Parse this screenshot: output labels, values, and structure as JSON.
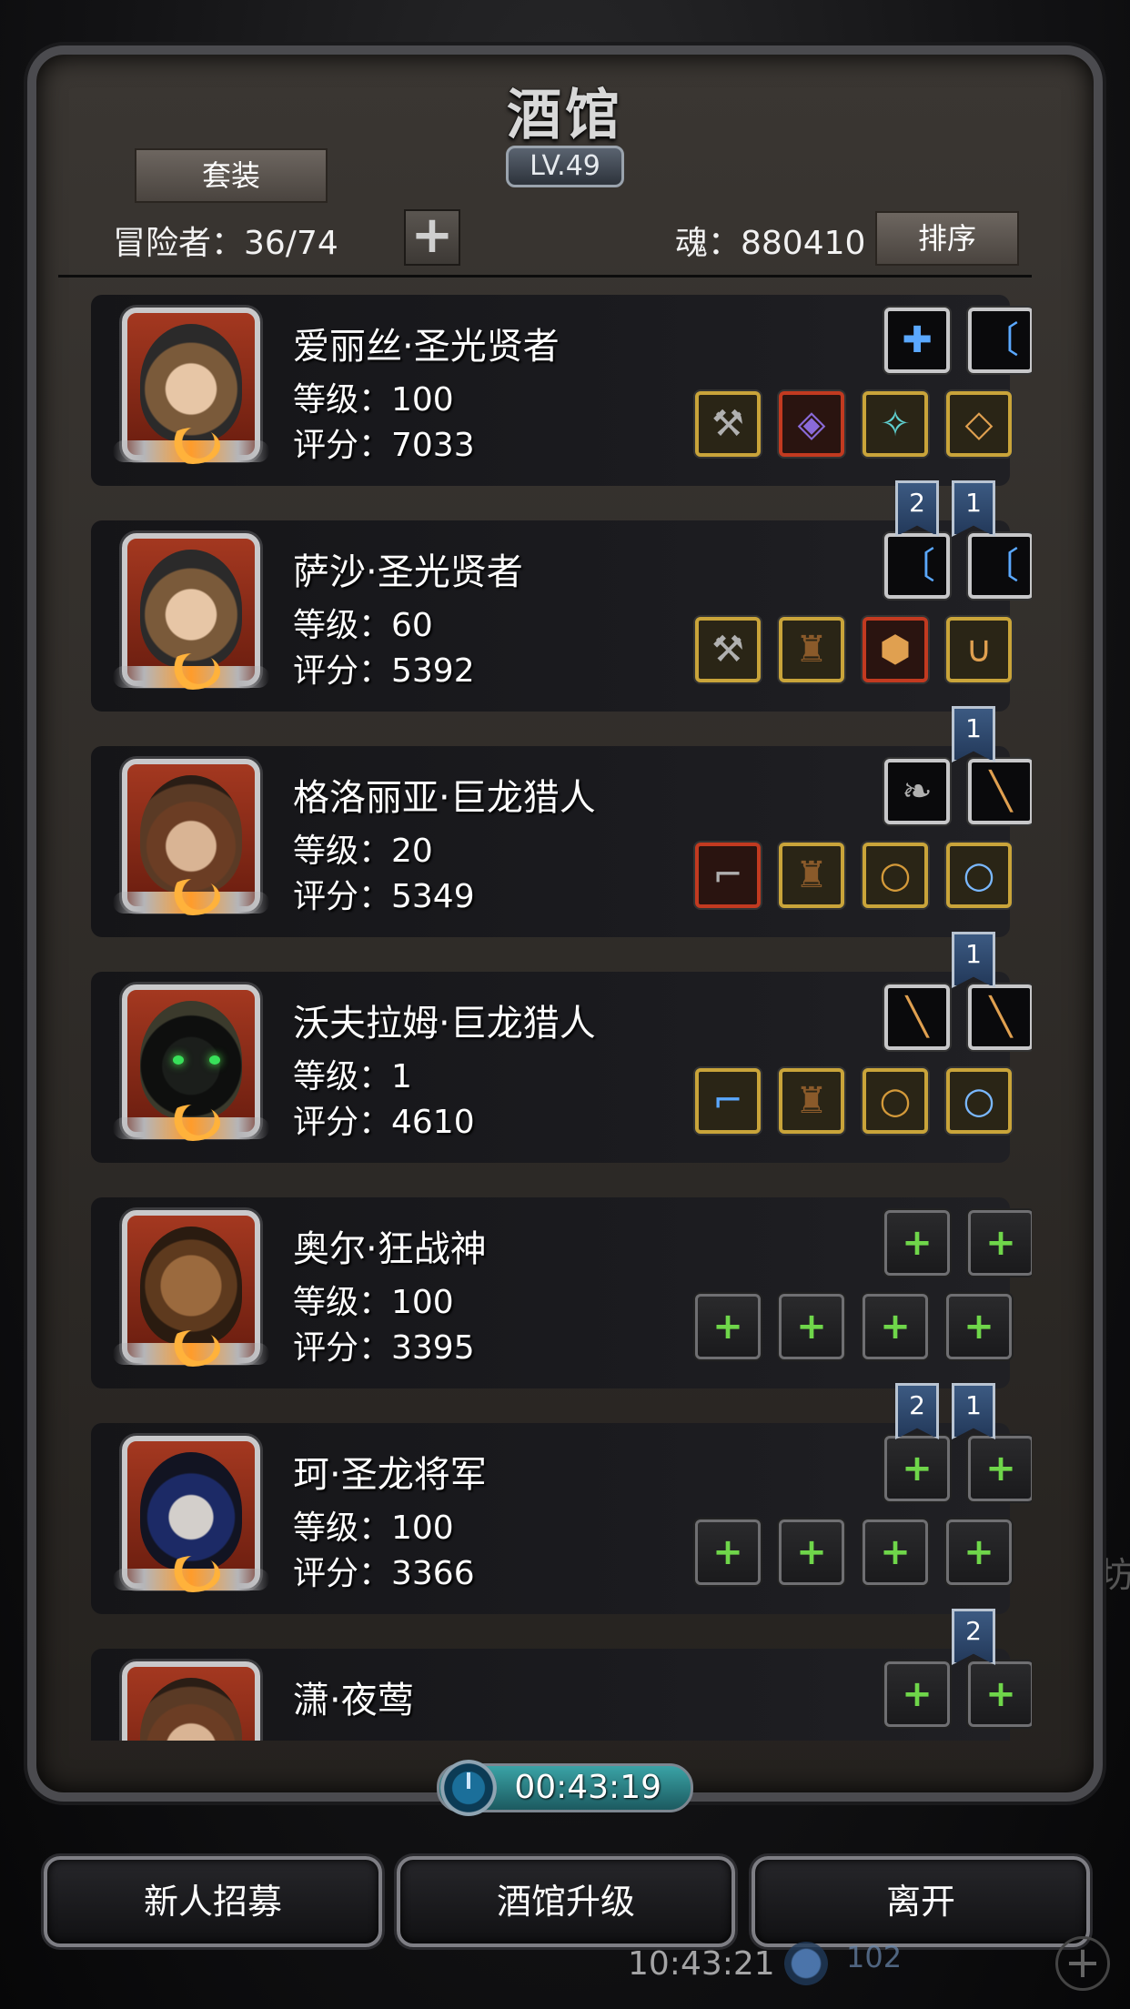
{
  "header": {
    "title": "酒馆",
    "level": "LV.49",
    "suit_button": "套装",
    "adventurers_label": "冒险者：36/74",
    "soul_label": "魂：880410",
    "sort_button": "排序"
  },
  "heroes": [
    {
      "name": "爱丽丝·圣光贤者",
      "level_text": "等级：100",
      "score_text": "评分：7033",
      "portrait_icon": "hooded-sage-portrait",
      "top_slots": [
        {
          "icon": "amulet-icon",
          "style": "white",
          "glyph": "✚",
          "color": "g-blue"
        },
        {
          "icon": "bow-icon",
          "style": "white",
          "glyph": "〔",
          "color": "g-blue"
        }
      ],
      "bottom_slots": [
        {
          "icon": "hammer-icon",
          "style": "gold",
          "glyph": "⚒",
          "color": "g-metal"
        },
        {
          "icon": "armor-icon",
          "style": "red",
          "glyph": "◈",
          "color": "g-purple"
        },
        {
          "icon": "pendant-icon",
          "style": "gold",
          "glyph": "✧",
          "color": "g-teal"
        },
        {
          "icon": "tablet-icon",
          "style": "gold",
          "glyph": "◇",
          "color": "g-orange"
        }
      ]
    },
    {
      "name": "萨沙·圣光贤者",
      "level_text": "等级：60",
      "score_text": "评分：5392",
      "portrait_icon": "hooded-sage-portrait",
      "top_slots": [
        {
          "icon": "bow-icon",
          "style": "white",
          "glyph": "〔",
          "color": "g-blue"
        },
        {
          "icon": "bow-icon",
          "style": "white",
          "glyph": "〔",
          "color": "g-blue"
        }
      ],
      "bottom_slots": [
        {
          "icon": "mace-icon",
          "style": "gold",
          "glyph": "⚒",
          "color": "g-metal"
        },
        {
          "icon": "cloak-icon",
          "style": "gold",
          "glyph": "♜",
          "color": "g-brown"
        },
        {
          "icon": "dice-icon",
          "style": "red",
          "glyph": "⬢",
          "color": "g-orange"
        },
        {
          "icon": "necklace-icon",
          "style": "gold",
          "glyph": "∪",
          "color": "g-orange"
        }
      ]
    },
    {
      "name": "格洛丽亚·巨龙猎人",
      "level_text": "等级：20",
      "score_text": "评分：5349",
      "portrait_icon": "hunter-portrait",
      "top_slots": [
        {
          "icon": "feather-icon",
          "style": "white",
          "glyph": "❧",
          "color": "g-metal"
        },
        {
          "icon": "sword-icon",
          "style": "white",
          "glyph": "╲",
          "color": "g-orange"
        }
      ],
      "bottom_slots": [
        {
          "icon": "pistol-icon",
          "style": "red",
          "glyph": "⌐",
          "color": "g-metal"
        },
        {
          "icon": "cloak-icon",
          "style": "gold",
          "glyph": "♜",
          "color": "g-brown"
        },
        {
          "icon": "ring-icon",
          "style": "gold",
          "glyph": "○",
          "color": "g-ring"
        },
        {
          "icon": "ring-icon",
          "style": "gold",
          "glyph": "○",
          "color": "g-ring-blue"
        }
      ]
    },
    {
      "name": "沃夫拉姆·巨龙猎人",
      "level_text": "等级：1",
      "score_text": "评分：4610",
      "portrait_icon": "hooded-hunter-portrait",
      "top_slots": [
        {
          "icon": "sword-icon",
          "style": "white",
          "glyph": "╲",
          "color": "g-orange"
        },
        {
          "icon": "sword-icon",
          "style": "white",
          "glyph": "╲",
          "color": "g-orange"
        }
      ],
      "bottom_slots": [
        {
          "icon": "pistol-icon",
          "style": "gold",
          "glyph": "⌐",
          "color": "g-blue"
        },
        {
          "icon": "cloak-icon",
          "style": "gold",
          "glyph": "♜",
          "color": "g-brown"
        },
        {
          "icon": "ring-icon",
          "style": "gold",
          "glyph": "○",
          "color": "g-ring"
        },
        {
          "icon": "ring-icon",
          "style": "gold",
          "glyph": "○",
          "color": "g-ring-blue"
        }
      ]
    },
    {
      "name": "奥尔·狂战神",
      "level_text": "等级：100",
      "score_text": "评分：3395",
      "portrait_icon": "berserker-portrait",
      "top_slots": [
        {
          "icon": "add-weapon-icon",
          "style": "empty",
          "glyph": "+",
          "color": "g-green"
        },
        {
          "icon": "add-weapon-icon",
          "style": "empty",
          "glyph": "+",
          "color": "g-green"
        }
      ],
      "bottom_slots": [
        {
          "icon": "add-weapon-icon",
          "style": "empty",
          "glyph": "+",
          "color": "g-green"
        },
        {
          "icon": "add-armor-icon",
          "style": "empty",
          "glyph": "+",
          "color": "g-green"
        },
        {
          "icon": "add-accessory-icon",
          "style": "empty",
          "glyph": "+",
          "color": "g-green"
        },
        {
          "icon": "add-accessory-icon",
          "style": "empty",
          "glyph": "+",
          "color": "g-green"
        }
      ]
    },
    {
      "name": "珂·圣龙将军",
      "level_text": "等级：100",
      "score_text": "评分：3366",
      "portrait_icon": "general-portrait",
      "top_slots": [
        {
          "icon": "add-weapon-icon",
          "style": "empty",
          "glyph": "+",
          "color": "g-green"
        },
        {
          "icon": "add-weapon-icon",
          "style": "empty",
          "glyph": "+",
          "color": "g-green"
        }
      ],
      "bottom_slots": [
        {
          "icon": "add-weapon-icon",
          "style": "empty",
          "glyph": "+",
          "color": "g-green"
        },
        {
          "icon": "add-armor-icon",
          "style": "empty",
          "glyph": "+",
          "color": "g-green"
        },
        {
          "icon": "add-accessory-icon",
          "style": "empty",
          "glyph": "+",
          "color": "g-green"
        },
        {
          "icon": "add-accessory-icon",
          "style": "empty",
          "glyph": "+",
          "color": "g-green"
        }
      ]
    },
    {
      "name": "潇·夜莺",
      "level_text": "",
      "score_text": "",
      "portrait_icon": "nightingale-portrait",
      "top_slots": [
        {
          "icon": "add-weapon-icon",
          "style": "empty",
          "glyph": "+",
          "color": "g-green"
        },
        {
          "icon": "add-weapon-icon",
          "style": "empty",
          "glyph": "+",
          "color": "g-green"
        }
      ],
      "bottom_slots": []
    }
  ],
  "flags": [
    {
      "after_card": 0,
      "labels": [
        "2",
        "1"
      ]
    },
    {
      "after_card": 1,
      "labels": [
        "1"
      ]
    },
    {
      "after_card": 2,
      "labels": [
        "1"
      ]
    },
    {
      "after_card": 4,
      "labels": [
        "2",
        "1"
      ]
    },
    {
      "after_card": 5,
      "labels": [
        "2"
      ]
    }
  ],
  "timer": "00:43:19",
  "bottom_buttons": {
    "recruit": "新人招募",
    "upgrade": "酒馆升级",
    "leave": "离开"
  },
  "background": {
    "clock": "10:43:21",
    "count": "102",
    "side_glyph": "坊",
    "corner_plus": "+"
  }
}
